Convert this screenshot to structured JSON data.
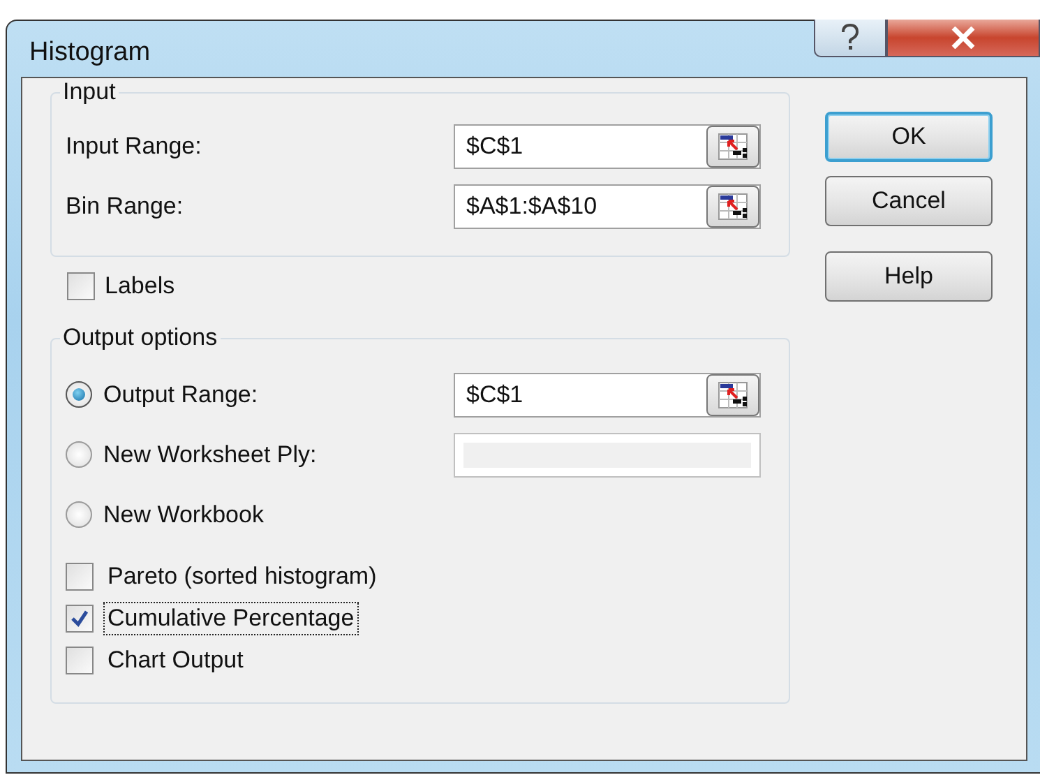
{
  "window": {
    "title": "Histogram"
  },
  "input_group": {
    "title": "Input",
    "fields": [
      {
        "label": "Input Range:",
        "value": "$C$1"
      },
      {
        "label": "Bin Range:",
        "value": "$A$1:$A$10"
      }
    ]
  },
  "labels_checkbox": {
    "label": "Labels",
    "checked": false
  },
  "output_group": {
    "title": "Output options",
    "options": [
      {
        "label": "Output Range:",
        "selected": true,
        "kind": "range",
        "value": "$C$1"
      },
      {
        "label": "New Worksheet Ply:",
        "selected": false,
        "kind": "text"
      },
      {
        "label": "New Workbook",
        "selected": false,
        "kind": "none"
      }
    ],
    "checkboxes": [
      {
        "label": "Pareto (sorted histogram)",
        "checked": false,
        "focused": false
      },
      {
        "label": "Cumulative Percentage",
        "checked": true,
        "focused": true
      },
      {
        "label": "Chart Output",
        "checked": false,
        "focused": false
      }
    ]
  },
  "buttons": [
    {
      "label": "OK",
      "default": true
    },
    {
      "label": "Cancel",
      "default": false
    },
    {
      "label": "Help",
      "default": false
    }
  ]
}
